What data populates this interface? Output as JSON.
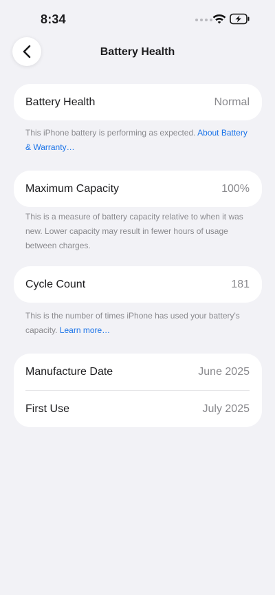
{
  "status_bar": {
    "time": "8:34"
  },
  "nav": {
    "back_icon": "chevron-left-icon",
    "title": "Battery Health"
  },
  "colors": {
    "background": "#f2f2f6",
    "card": "#ffffff",
    "link": "#1a73e8",
    "secondary_text": "#8a8a8e"
  },
  "battery_health": {
    "label": "Battery Health",
    "value": "Normal",
    "note": "This iPhone battery is performing as expected.",
    "note_link": "About Battery & Warranty…"
  },
  "maximum_capacity": {
    "label": "Maximum Capacity",
    "value": "100%",
    "note": "This is a measure of battery capacity relative to when it was new. Lower capacity may result in fewer hours of usage between charges."
  },
  "cycle_count": {
    "label": "Cycle Count",
    "value": "181",
    "note": "This is the number of times iPhone has used your battery's capacity.",
    "note_link": "Learn more…"
  },
  "dates": {
    "manufacture_label": "Manufacture Date",
    "manufacture_value": "June 2025",
    "first_use_label": "First Use",
    "first_use_value": "July 2025"
  }
}
